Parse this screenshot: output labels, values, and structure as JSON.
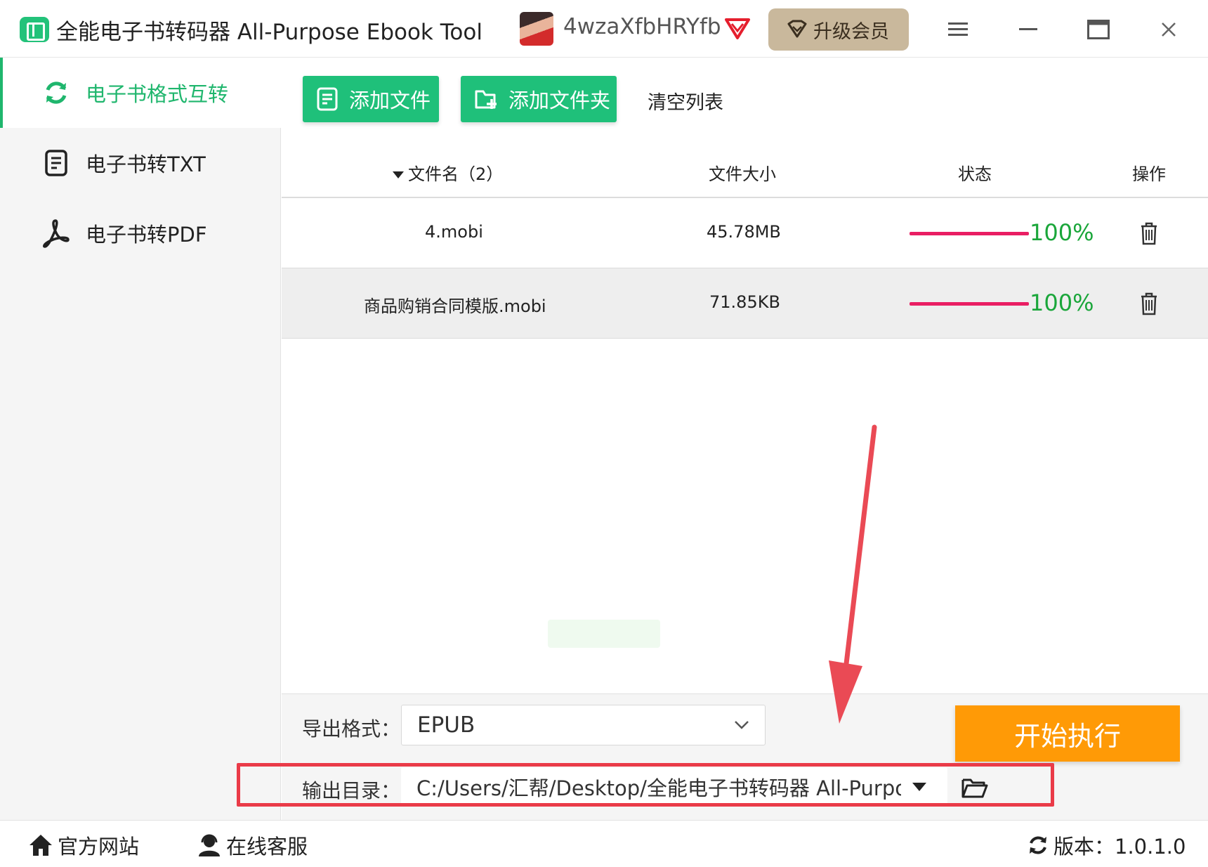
{
  "app": {
    "title": "全能电子书转码器 All-Purpose Ebook Tool",
    "username": "4wzaXfbHRYfb",
    "upgrade_label": "升级会员"
  },
  "sidebar": {
    "items": [
      {
        "label": "电子书格式互转",
        "icon": "refresh-icon",
        "active": true
      },
      {
        "label": "电子书转TXT",
        "icon": "text-document-icon",
        "active": false
      },
      {
        "label": "电子书转PDF",
        "icon": "pdf-icon",
        "active": false
      }
    ]
  },
  "toolbar": {
    "add_file": "添加文件",
    "add_folder": "添加文件夹",
    "clear_list": "清空列表"
  },
  "table": {
    "headers": {
      "name": "文件名（2）",
      "size": "文件大小",
      "status": "状态",
      "action": "操作"
    },
    "rows": [
      {
        "name": "4.mobi",
        "size": "45.78MB",
        "progress": 1.0,
        "status": "100%"
      },
      {
        "name": "商品购销合同模版.mobi",
        "size": "71.85KB",
        "progress": 1.0,
        "status": "100%"
      }
    ]
  },
  "output": {
    "format_label": "导出格式：",
    "format_value": "EPUB",
    "dir_label": "输出目录：",
    "dir_value": "C:/Users/汇帮/Desktop/全能电子书转码器 All-Purpos",
    "start_label": "开始执行"
  },
  "statusbar": {
    "website": "官方网站",
    "support": "在线客服",
    "version": "版本：1.0.1.0"
  },
  "colors": {
    "brand_green": "#1fc07a",
    "accent_orange": "#ff9a06",
    "progress_pink": "#e91e63",
    "percent_green": "#1aa63a",
    "annotation_red": "#ea3b48"
  }
}
